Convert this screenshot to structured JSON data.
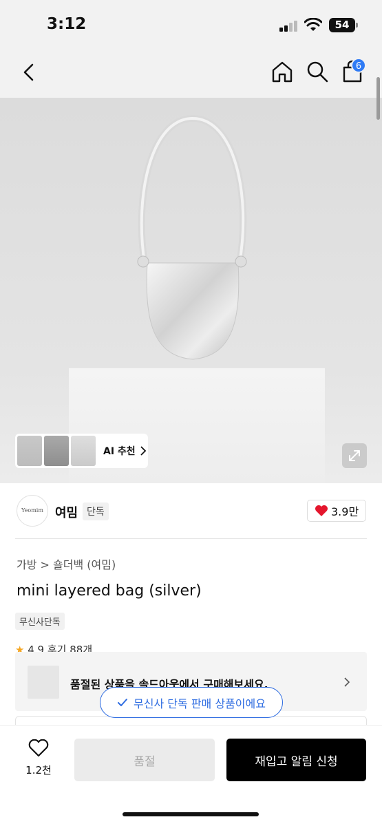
{
  "status_bar": {
    "time": "3:12",
    "battery": "54"
  },
  "header": {
    "back_icon": "chevron-left-icon",
    "home_icon": "home-icon",
    "search_icon": "search-icon",
    "cart_icon": "shopping-bag-icon",
    "cart_count": "6",
    "badge_color": "#2f7bf5"
  },
  "gallery": {
    "ai_label": "AI 추천",
    "expand_icon": "expand-icon"
  },
  "brand": {
    "logo_text": "Yeomim",
    "name": "여밈",
    "tag": "단독",
    "like_count": "3.9만",
    "heart_color": "#e4162d"
  },
  "product": {
    "breadcrumb": "가방 > 숄더백 (여밈)",
    "title": "mini layered bag (silver)",
    "badge": "무신사단독",
    "rating": "4.9",
    "reviews": "후기 88개"
  },
  "soldout_card": {
    "text": "품절된 상품을 솔드아웃에서 구매해보세요."
  },
  "toast": {
    "text": "무신사 단독 판매 상품이에요",
    "color": "#2f6de1"
  },
  "bottom_bar": {
    "wish_count": "1.2천",
    "soldout_label": "품절",
    "restock_label": "재입고 알림 신청"
  }
}
